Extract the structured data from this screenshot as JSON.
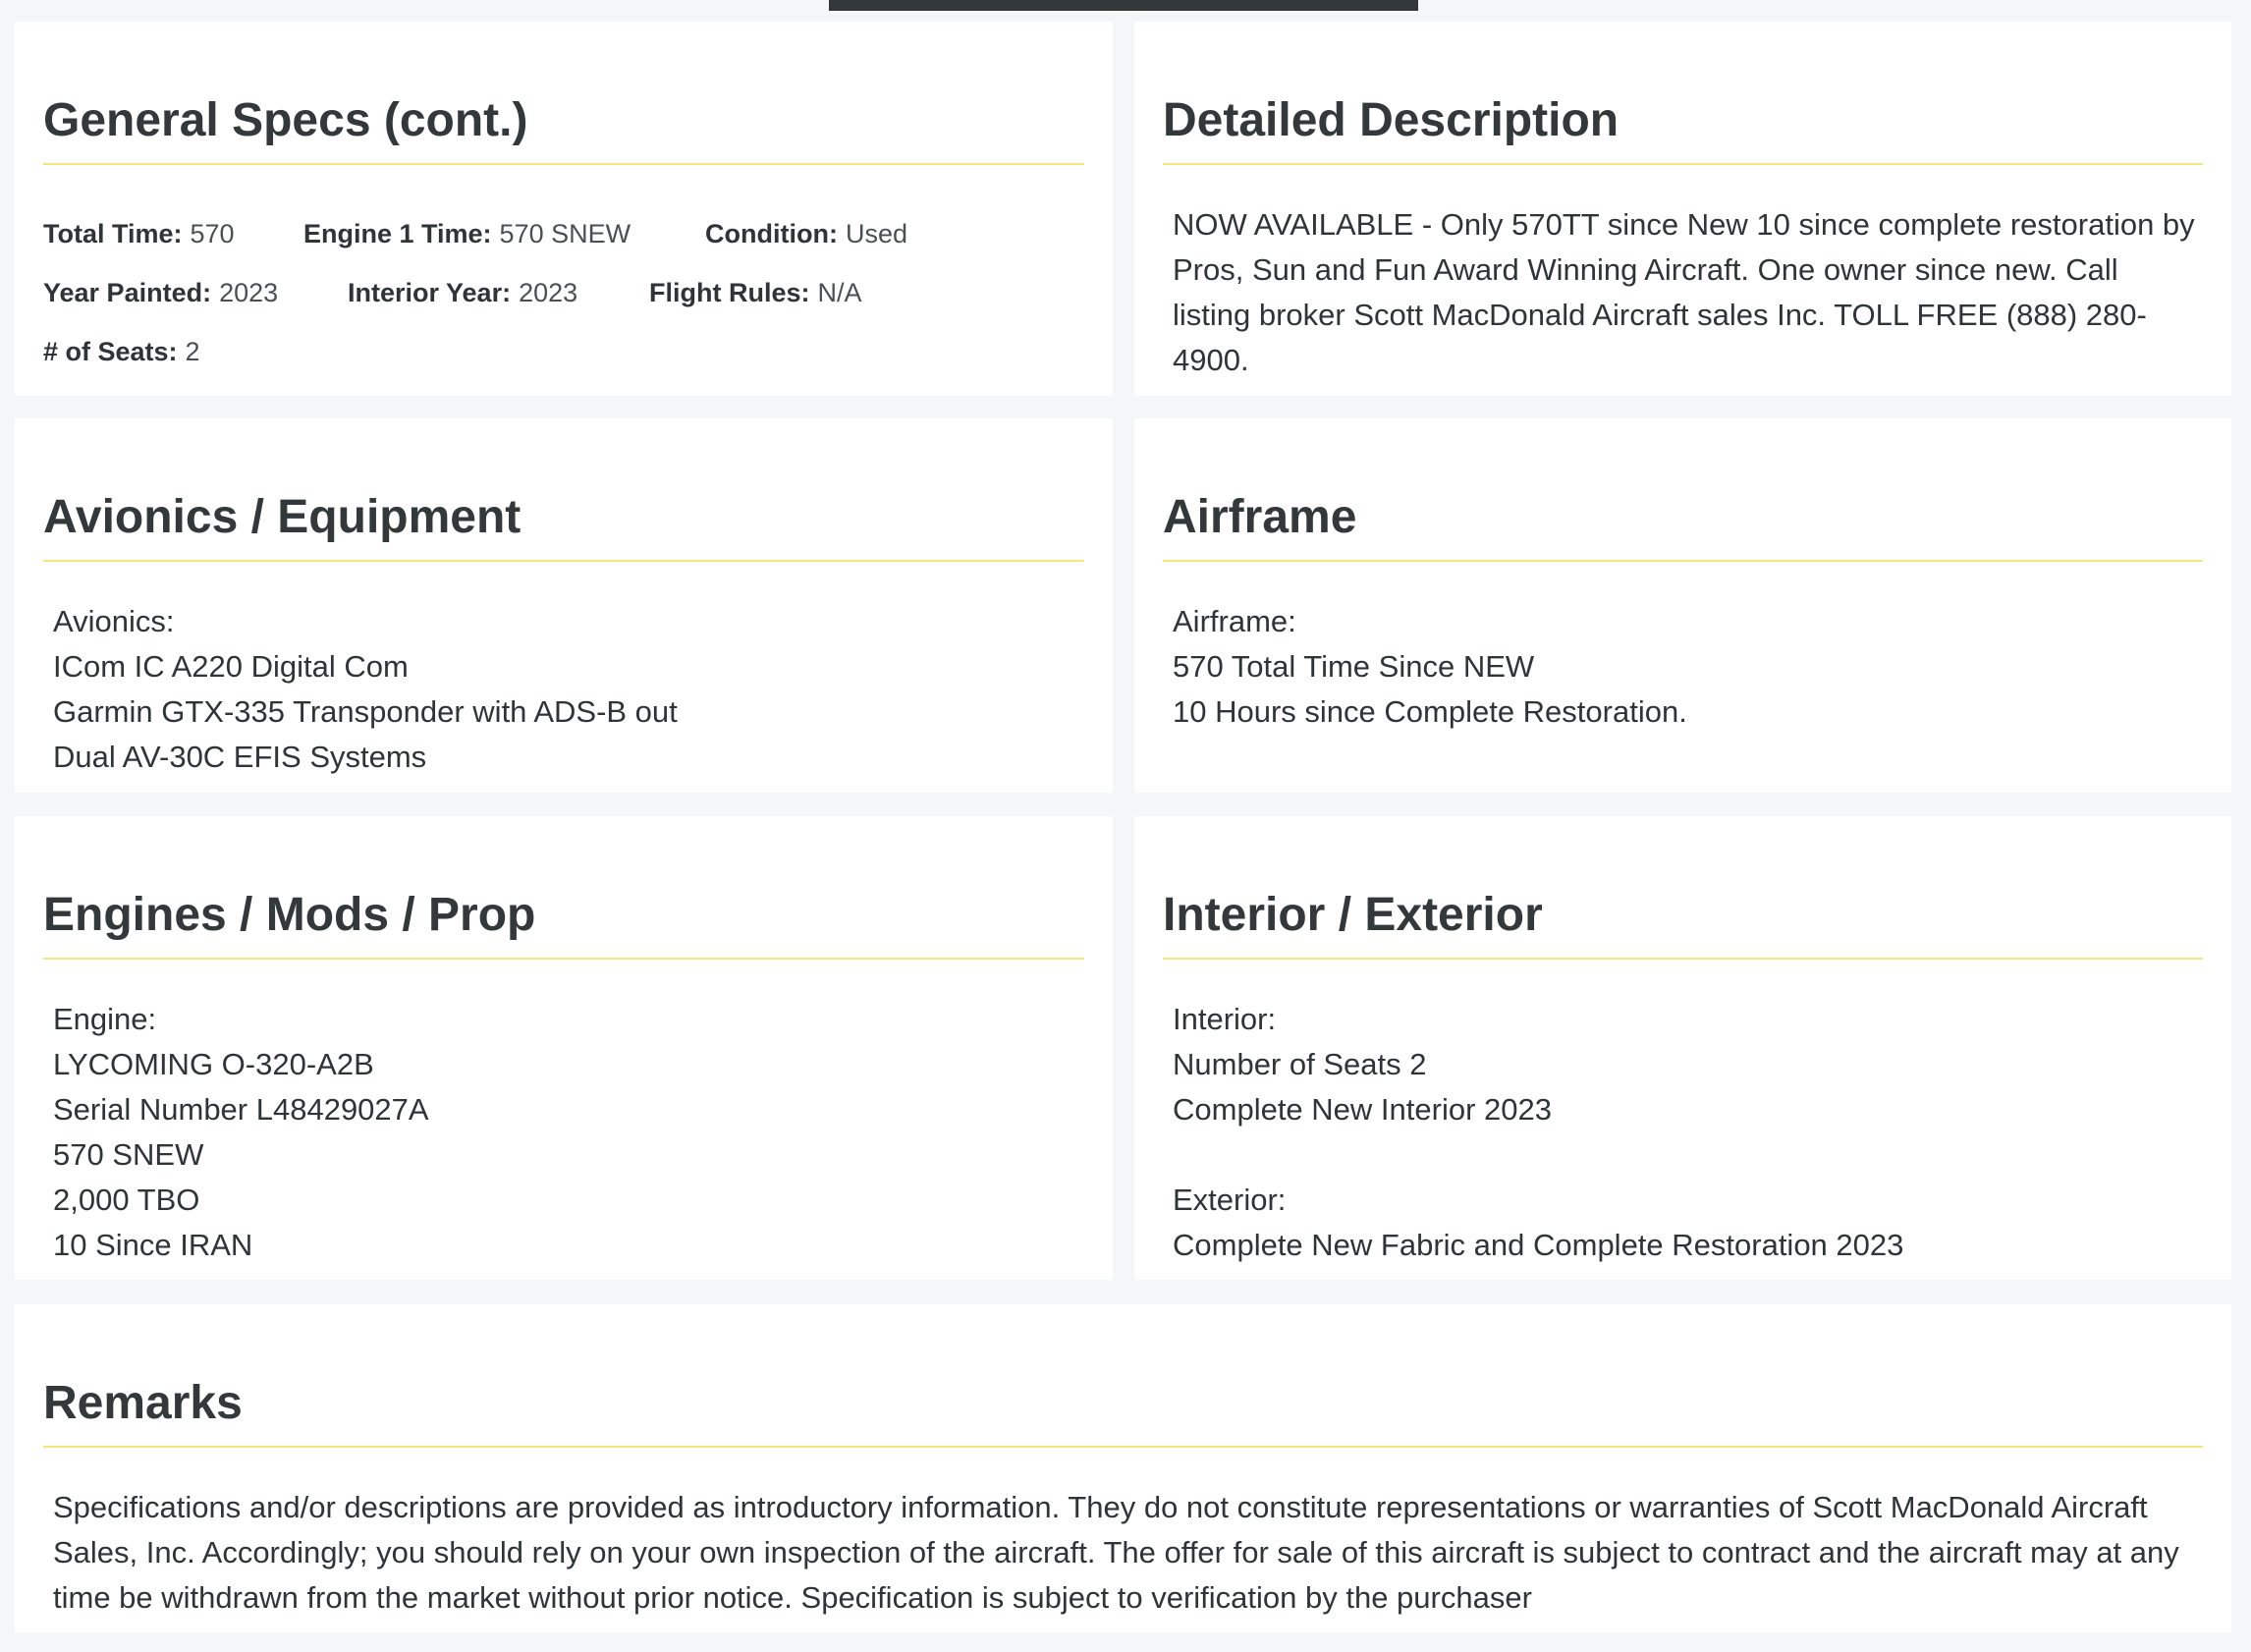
{
  "general_specs": {
    "title": "General Specs (cont.)",
    "rows": [
      [
        {
          "label": "Total Time:",
          "value": "570"
        },
        {
          "label": "Engine 1 Time:",
          "value": "570 SNEW"
        },
        {
          "label": "Condition:",
          "value": "Used"
        }
      ],
      [
        {
          "label": "Year Painted:",
          "value": "2023"
        },
        {
          "label": "Interior Year:",
          "value": "2023"
        },
        {
          "label": "Flight Rules:",
          "value": "N/A"
        }
      ],
      [
        {
          "label": "# of Seats:",
          "value": "2"
        }
      ]
    ]
  },
  "detailed_description": {
    "title": "Detailed Description",
    "text": "NOW AVAILABLE - Only 570TT since New 10 since complete restoration by Pros,  Sun and Fun Award Winning Aircraft. One owner since new. Call listing broker Scott MacDonald Aircraft sales Inc. TOLL FREE (888) 280-4900."
  },
  "avionics": {
    "title": "Avionics / Equipment",
    "lines": [
      "Avionics:",
      "ICom IC A220 Digital Com",
      "Garmin GTX-335 Transponder with ADS-B out",
      "Dual AV-30C EFIS Systems"
    ]
  },
  "airframe": {
    "title": "Airframe",
    "lines": [
      "Airframe:",
      "570 Total Time Since NEW",
      "10 Hours since Complete Restoration."
    ]
  },
  "engines": {
    "title": "Engines / Mods / Prop",
    "lines": [
      "Engine:",
      "LYCOMING O-320-A2B",
      "Serial Number L48429027A",
      "570 SNEW",
      "2,000 TBO",
      "10 Since IRAN"
    ]
  },
  "interior_exterior": {
    "title": "Interior / Exterior",
    "lines": [
      "Interior:",
      "Number of Seats 2",
      "Complete New Interior 2023",
      "",
      "Exterior:",
      "Complete New Fabric and Complete Restoration 2023"
    ]
  },
  "remarks": {
    "title": "Remarks",
    "text": "Specifications and/or descriptions are provided as introductory information. They do not constitute representations or warranties of Scott MacDonald Aircraft Sales, Inc. Accordingly; you should rely on your own inspection of the aircraft. The offer for sale of this aircraft is subject to contract and the aircraft may at any time be withdrawn from the market without prior notice. Specification is subject to verification by the purchaser"
  }
}
